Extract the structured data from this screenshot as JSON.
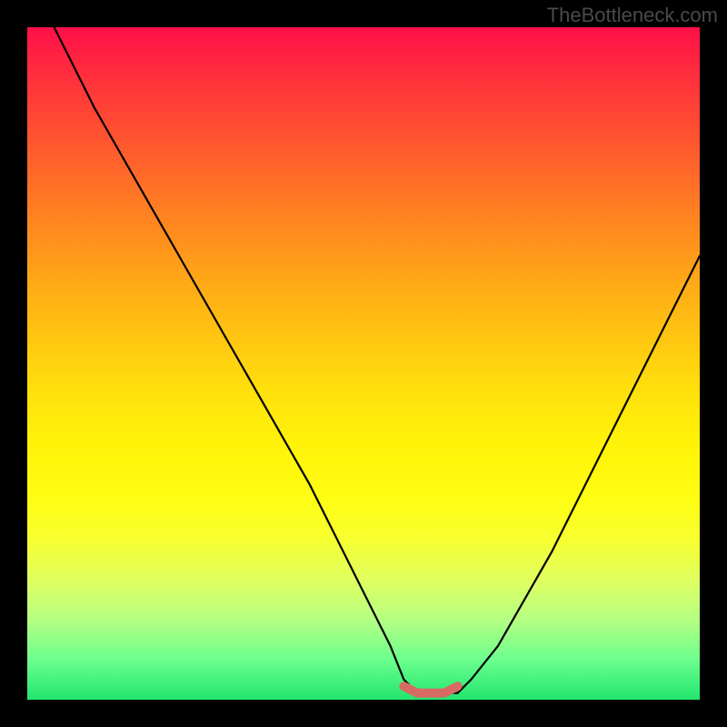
{
  "watermark": "TheBottleneck.com",
  "chart_data": {
    "type": "line",
    "title": "",
    "xlabel": "",
    "ylabel": "",
    "xlim": [
      0,
      100
    ],
    "ylim": [
      0,
      100
    ],
    "series": [
      {
        "name": "bottleneck-curve",
        "x": [
          4,
          10,
          18,
          26,
          34,
          42,
          50,
          54,
          56,
          58,
          60,
          62,
          64,
          66,
          70,
          78,
          86,
          94,
          100
        ],
        "values": [
          100,
          88,
          74,
          60,
          46,
          32,
          16,
          8,
          3,
          1,
          1,
          1,
          1,
          3,
          8,
          22,
          38,
          54,
          66
        ]
      },
      {
        "name": "bottleneck-floor",
        "x": [
          56,
          58,
          60,
          62,
          64
        ],
        "values": [
          2,
          1,
          1,
          1,
          2
        ]
      }
    ],
    "colors": {
      "curve": "#000000",
      "floor": "#d76b63",
      "background_top": "#ff0f4a",
      "background_bottom": "#22e56e"
    }
  }
}
